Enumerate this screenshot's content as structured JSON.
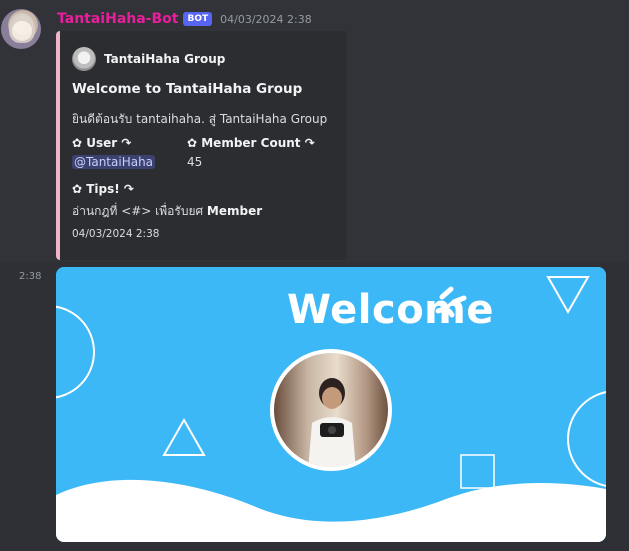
{
  "message": {
    "username": "TantaiHaha-Bot",
    "bot_tag": "BOT",
    "timestamp": "04/03/2024 2:38",
    "side_time": "2:38",
    "avatar_icon": "anime-girl-avatar",
    "username_color": "#e91e9c"
  },
  "embed": {
    "accent_color": "#f0b3c7",
    "author": {
      "name": "TantaiHaha Group",
      "icon": "group-avatar-icon"
    },
    "title": "Welcome to TantaiHaha Group",
    "description": "ยินดีต้อนรับ tantaihaha. สู่ TantaiHaha Group",
    "fields": [
      {
        "name": "✿ User ↷",
        "value": "@TantaiHaha"
      },
      {
        "name": "✿ Member Count ↷",
        "value": "45"
      },
      {
        "name": "✿ Tips! ↷",
        "value_prefix": "อ่านกฎที่ <#> เพื่อรับยศ ",
        "value_bold": "Member"
      }
    ],
    "footer": "04/03/2024 2:38"
  },
  "welcome_card": {
    "text": "Welcome",
    "background": "#3db8f6"
  }
}
